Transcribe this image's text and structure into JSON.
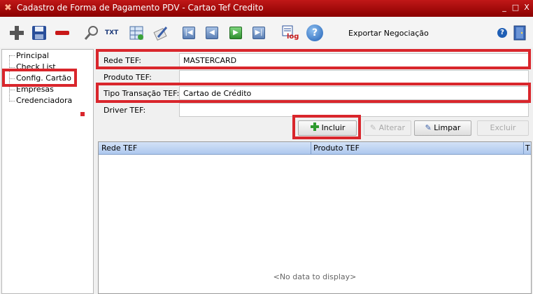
{
  "window": {
    "title": "Cadastro de Forma de Pagamento PDV - Cartao Tef Credito",
    "controls": [
      "_",
      "□",
      "X"
    ]
  },
  "toolbar": {
    "txt_label": "TXT",
    "log_label": "log",
    "help_label": "?",
    "export_label": "Exportar Negociação",
    "help_small_label": "?",
    "icons": [
      "plus-icon",
      "save-icon",
      "minus-icon",
      "search-icon",
      "txt-icon",
      "refresh-icon",
      "edit-icon",
      "first-icon",
      "prev-icon",
      "next-icon",
      "last-icon",
      "log-icon",
      "help-icon"
    ]
  },
  "sidebar": {
    "items": [
      {
        "label": "Principal"
      },
      {
        "label": "Check List"
      },
      {
        "label": "Config. Cartão"
      },
      {
        "label": "Empresas"
      },
      {
        "label": "Credenciadora"
      }
    ]
  },
  "form": {
    "rede_label": "Rede TEF:",
    "rede_value": "MASTERCARD",
    "produto_label": "Produto TEF:",
    "produto_value": "",
    "tipo_label": "Tipo Transação TEF:",
    "tipo_value": "Cartao de Crédito",
    "driver_label": "Driver TEF:",
    "driver_value": ""
  },
  "actions": {
    "incluir": "Incluir",
    "alterar": "Alterar",
    "limpar": "Limpar",
    "excluir": "Excluir"
  },
  "grid": {
    "columns": [
      "Rede TEF",
      "Produto TEF",
      "T"
    ],
    "empty_text": "<No data to display>"
  },
  "colors": {
    "highlight": "#d9262c",
    "titlebar": "#a80c0c"
  }
}
